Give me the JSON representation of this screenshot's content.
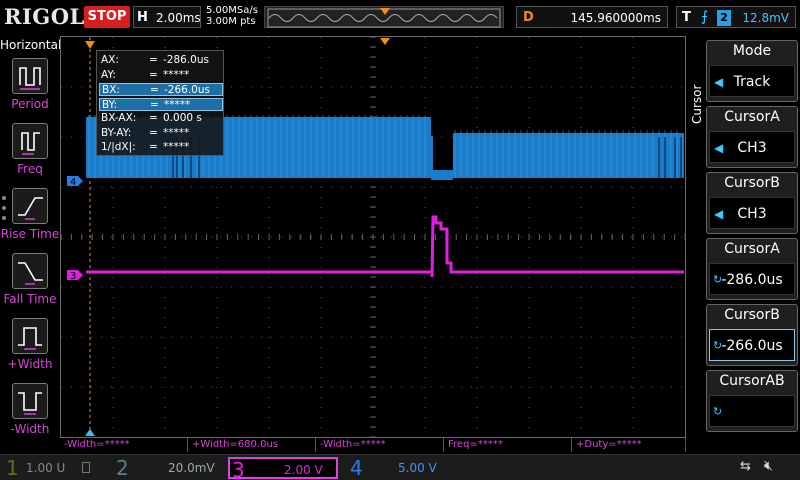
{
  "topbar": {
    "brand": "RIGOL",
    "run_state": "STOP",
    "timebase_label": "H",
    "timebase_value": "2.00ms",
    "sample_rate": "5.00MSa/s",
    "memory_depth": "3.00M pts",
    "delay_label": "D",
    "delay_value": "145.960000ms",
    "trigger_label": "T",
    "trigger_source": "2",
    "trigger_level": "12.8mV",
    "trigger_edge_icon": "rising-edge-icon"
  },
  "left_menu": {
    "title": "Horizontal",
    "items": [
      {
        "label": "Period",
        "icon": "period-icon"
      },
      {
        "label": "Freq",
        "icon": "frequency-icon"
      },
      {
        "label": "Rise Time",
        "icon": "rise-time-icon"
      },
      {
        "label": "Fall Time",
        "icon": "fall-time-icon"
      },
      {
        "label": "+Width",
        "icon": "positive-width-icon"
      },
      {
        "label": "-Width",
        "icon": "negative-width-icon"
      }
    ]
  },
  "cursor_readout": [
    {
      "key": "AX:",
      "eq": "=",
      "value": "-286.0us",
      "selected": false
    },
    {
      "key": "AY:",
      "eq": "=",
      "value": "*****",
      "selected": false
    },
    {
      "key": "BX:",
      "eq": "=",
      "value": "-266.0us",
      "selected": true
    },
    {
      "key": "BY:",
      "eq": "=",
      "value": "*****",
      "selected": true
    },
    {
      "key": "BX-AX:",
      "eq": "=",
      "value": "0.000 s",
      "selected": false
    },
    {
      "key": "BY-AY:",
      "eq": "=",
      "value": "*****",
      "selected": false
    },
    {
      "key": "1/|dX|:",
      "eq": "=",
      "value": "*****",
      "selected": false
    }
  ],
  "channel_markers": {
    "ch4": "4",
    "ch3": "3"
  },
  "waveforms": {
    "ch4_color": "#1a7cc8",
    "ch3_color": "#e020e0"
  },
  "measurements": [
    "-Width=*****",
    "+Width=680.0us",
    "-Width=*****",
    "Freq=*****",
    "+Duty=*****"
  ],
  "right_menu": {
    "tab": "Cursor",
    "items": [
      {
        "title": "Mode",
        "value": "Track",
        "control": "arrow"
      },
      {
        "title": "CursorA",
        "value": "CH3",
        "control": "arrow"
      },
      {
        "title": "CursorB",
        "value": "CH3",
        "control": "arrow"
      },
      {
        "title": "CursorA",
        "value": "-286.0us",
        "control": "knob"
      },
      {
        "title": "CursorB",
        "value": "-266.0us",
        "control": "knob"
      },
      {
        "title": "CursorAB",
        "value": "",
        "control": "knob"
      }
    ]
  },
  "status": {
    "ch1": {
      "num": "1",
      "value": "1.00 U",
      "color": "#e8e000"
    },
    "ch2": {
      "num": "2",
      "value": "20.0mV",
      "color": "#29c8f0"
    },
    "ch3": {
      "num": "3",
      "value": "2.00 V",
      "color": "#e020e0"
    },
    "ch4": {
      "num": "4",
      "value": "5.00 V",
      "color": "#2a7de8"
    }
  },
  "colors": {
    "accent_orange": "#f08c1e",
    "ch4_blue": "#1a7cc8",
    "ch3_magenta": "#e020e0",
    "stop_red": "#d62020"
  }
}
